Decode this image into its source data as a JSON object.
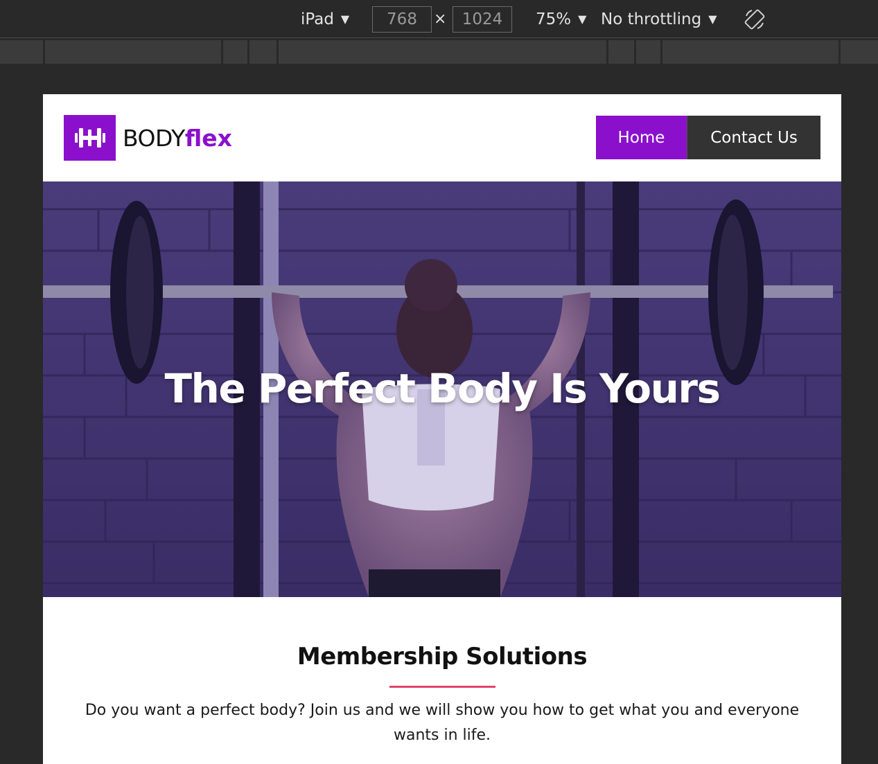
{
  "devtools": {
    "device": "iPad",
    "width": "768",
    "height": "1024",
    "times": "×",
    "zoom": "75%",
    "throttling": "No throttling",
    "caret": "▼"
  },
  "site": {
    "brand_part1": "BODY",
    "brand_part2": "flex",
    "nav": {
      "home": "Home",
      "contact": "Contact Us"
    },
    "hero_title": "The Perfect Body Is Yours",
    "section_title": "Membership Solutions",
    "section_text": "Do you want a perfect body? Join us and we will show you how to get what you and everyone wants in life."
  },
  "colors": {
    "brand_purple": "#8b10cc",
    "nav_dark": "#333333",
    "accent_line": "#e0436a",
    "hero_overlay": "#3b2a78"
  },
  "icons": {
    "logo": "dumbbell-icon",
    "rotate": "rotate-device-icon"
  }
}
